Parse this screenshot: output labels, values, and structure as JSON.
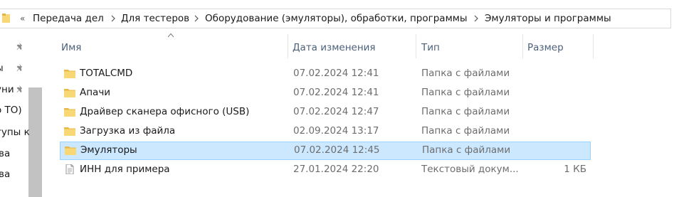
{
  "address": {
    "overflow_glyph": "«",
    "crumbs": [
      "Передача дел",
      "Для тестеров",
      "Оборудование (эмуляторы), обработки, программы",
      "Эмуляторы и программы"
    ]
  },
  "nav": {
    "items": [
      {
        "label": "",
        "pinned": true
      },
      {
        "label": "ы",
        "pinned": true
      },
      {
        "label": "уни",
        "pinned": true
      },
      {
        "label": "о ТО)",
        "pinned": false
      },
      {
        "label": "тупы к",
        "pinned": false
      },
      {
        "label": "ва",
        "pinned": false
      },
      {
        "label": "ва",
        "pinned": false
      }
    ]
  },
  "columns": {
    "name": "Имя",
    "date": "Дата изменения",
    "type": "Тип",
    "size": "Размер",
    "sort_indicator": "ascending"
  },
  "files": [
    {
      "name": "TOTALCMD",
      "date": "07.02.2024 12:41",
      "type": "Папка с файлами",
      "size": "",
      "icon": "folder-icon",
      "selected": false
    },
    {
      "name": "Апачи",
      "date": "07.02.2024 12:41",
      "type": "Папка с файлами",
      "size": "",
      "icon": "folder-icon",
      "selected": false
    },
    {
      "name": "Драйвер сканера офисного (USB)",
      "date": "07.02.2024 12:47",
      "type": "Папка с файлами",
      "size": "",
      "icon": "folder-icon",
      "selected": false
    },
    {
      "name": "Загрузка из файла",
      "date": "02.09.2024 13:17",
      "type": "Папка с файлами",
      "size": "",
      "icon": "folder-icon",
      "selected": false
    },
    {
      "name": "Эмуляторы",
      "date": "07.02.2024 12:45",
      "type": "Папка с файлами",
      "size": "",
      "icon": "folder-icon",
      "selected": true
    },
    {
      "name": "ИНН для примера",
      "date": "27.01.2024 22:20",
      "type": "Текстовый докум...",
      "size": "1 КБ",
      "icon": "text-file-icon",
      "selected": false
    }
  ],
  "colors": {
    "selection_fill": "#cce8ff",
    "selection_border": "#99d1ff",
    "folder_yellow": "#f8d775",
    "header_text": "#4c607a"
  }
}
